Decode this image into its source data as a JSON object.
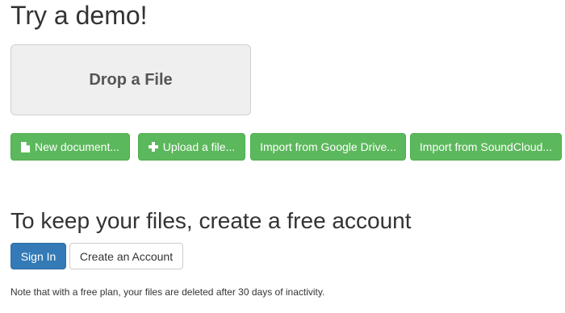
{
  "title": "Try a demo!",
  "dropzone": {
    "label": "Drop a File"
  },
  "actions": {
    "new_document": {
      "label": "New document...",
      "icon": "file-icon"
    },
    "upload_file": {
      "label": "Upload a file...",
      "icon": "plus-icon"
    },
    "import_google_drive": {
      "label": "Import from Google Drive..."
    },
    "import_soundcloud": {
      "label": "Import from SoundCloud..."
    }
  },
  "account": {
    "heading": "To keep your files, create a free account",
    "sign_in_label": "Sign In",
    "create_account_label": "Create an Account"
  },
  "note": "Note that with a free plan, your files are deleted after 30 days of inactivity.",
  "colors": {
    "success": "#5cb85c",
    "primary": "#337ab7",
    "dropzone_bg": "#efefef"
  }
}
